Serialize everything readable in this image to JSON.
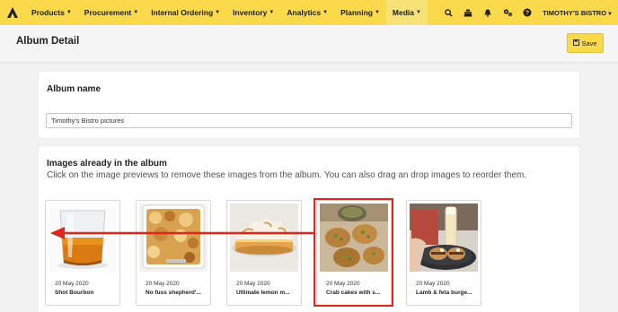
{
  "nav": {
    "items": [
      {
        "label": "Products"
      },
      {
        "label": "Procurement"
      },
      {
        "label": "Internal Ordering"
      },
      {
        "label": "Inventory"
      },
      {
        "label": "Analytics"
      },
      {
        "label": "Planning"
      },
      {
        "label": "Media"
      }
    ],
    "active_item": "Media",
    "user": "TIMOTHY'S BISTRO",
    "icons": [
      "search-icon",
      "cash-register-icon",
      "bell-icon",
      "settings-icon",
      "help-icon"
    ]
  },
  "page": {
    "title": "Album Detail",
    "save_label": "Save"
  },
  "album": {
    "name_label": "Album name",
    "name_value": "Timothy's Bistro pictures"
  },
  "images_section": {
    "title": "Images already in the album",
    "description": "Click on the image previews to remove these images from the album. You can also drag an drop images to reorder them."
  },
  "images": [
    {
      "date": "20 May 2020",
      "name": "Shot Bourbon",
      "subject": "bourbon-glass"
    },
    {
      "date": "20 May 2020",
      "name": "No fuss shepherd'...",
      "subject": "shepherds-pie"
    },
    {
      "date": "20 May 2020",
      "name": "Ultimate lemon m...",
      "subject": "lemon-meringue-pie"
    },
    {
      "date": "20 May 2020",
      "name": "Crab cakes with s...",
      "subject": "crab-cakes"
    },
    {
      "date": "20 May 2020",
      "name": "Lamb & feta burge...",
      "subject": "lamb-feta-burger"
    }
  ],
  "annotation": {
    "highlighted_image": "Crab cakes with s...",
    "arrow_target": "Shot Bourbon",
    "color": "#e0251b"
  },
  "colors": {
    "brand": "#fad94a",
    "active_tab": "#f7e277"
  }
}
